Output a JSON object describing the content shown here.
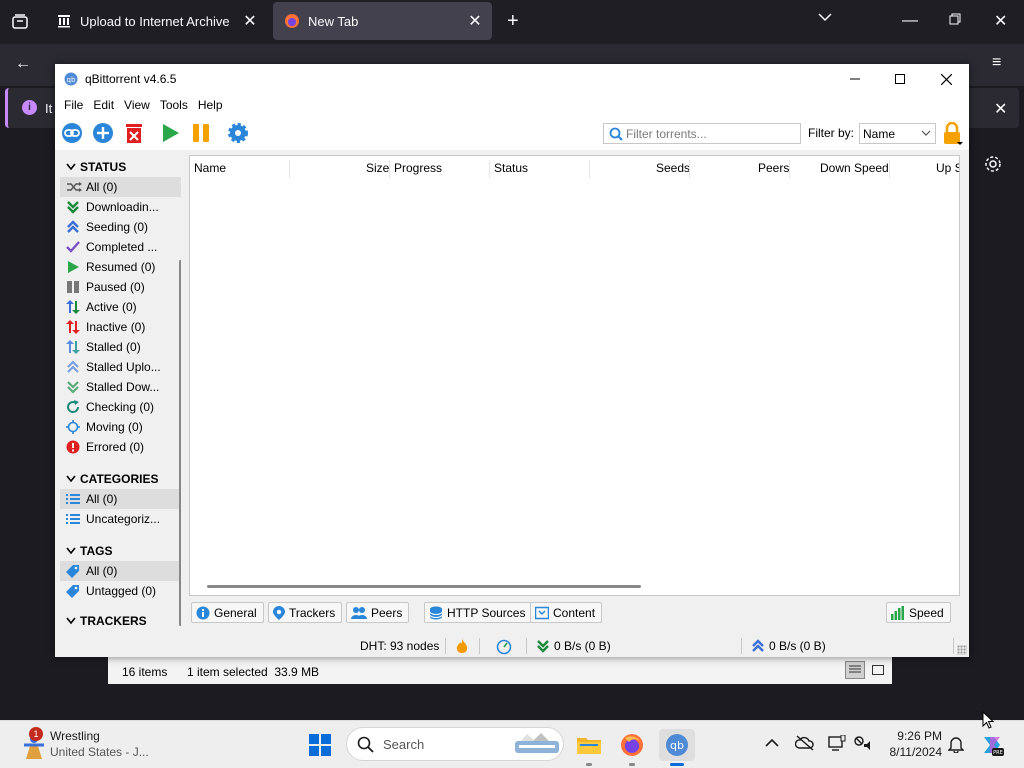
{
  "browser": {
    "tabs": [
      {
        "title": "Upload to Internet Archive"
      },
      {
        "title": "New Tab"
      }
    ],
    "notice_prefix": "It"
  },
  "qbt": {
    "title": "qBittorrent v4.6.5",
    "menu": [
      "File",
      "Edit",
      "View",
      "Tools",
      "Help"
    ],
    "filter": {
      "placeholder": "Filter torrents...",
      "by_label": "Filter by:",
      "by_value": "Name"
    },
    "sidebar": {
      "status_header": "STATUS",
      "status_items": [
        {
          "label": "All (0)",
          "icon": "shuffle-icon"
        },
        {
          "label": "Downloadin...",
          "icon": "double-chevron-down-icon"
        },
        {
          "label": "Seeding (0)",
          "icon": "double-chevron-up-icon"
        },
        {
          "label": "Completed ...",
          "icon": "checkmark-icon"
        },
        {
          "label": "Resumed (0)",
          "icon": "play-icon"
        },
        {
          "label": "Paused (0)",
          "icon": "pause-icon"
        },
        {
          "label": "Active (0)",
          "icon": "active-arrows-icon"
        },
        {
          "label": "Inactive (0)",
          "icon": "inactive-arrows-icon"
        },
        {
          "label": "Stalled (0)",
          "icon": "stalled-arrows-icon"
        },
        {
          "label": "Stalled Uplo...",
          "icon": "stalled-up-icon"
        },
        {
          "label": "Stalled Dow...",
          "icon": "stalled-down-icon"
        },
        {
          "label": "Checking (0)",
          "icon": "refresh-icon"
        },
        {
          "label": "Moving (0)",
          "icon": "move-icon"
        },
        {
          "label": "Errored (0)",
          "icon": "error-icon"
        }
      ],
      "categories_header": "CATEGORIES",
      "category_items": [
        {
          "label": "All (0)"
        },
        {
          "label": "Uncategoriz..."
        }
      ],
      "tags_header": "TAGS",
      "tag_items": [
        {
          "label": "All (0)"
        },
        {
          "label": "Untagged (0)"
        }
      ],
      "trackers_header": "TRACKERS"
    },
    "columns": [
      "Name",
      "Size",
      "Progress",
      "Status",
      "Seeds",
      "Peers",
      "Down Speed",
      "Up S"
    ],
    "bottom_tabs": {
      "general": "General",
      "trackers": "Trackers",
      "peers": "Peers",
      "http": "HTTP Sources",
      "content": "Content",
      "speed": "Speed"
    },
    "status": {
      "dht": "DHT: 93 nodes",
      "down": "0 B/s (0 B)",
      "up": "0 B/s (0 B)"
    }
  },
  "explorer": {
    "items": "16 items",
    "selected": "1 item selected  33.9 MB"
  },
  "taskbar": {
    "weather_title": "Wrestling",
    "weather_sub": "United States - J...",
    "weather_badge": "1",
    "search": "Search",
    "time": "9:26 PM",
    "date": "8/11/2024"
  }
}
